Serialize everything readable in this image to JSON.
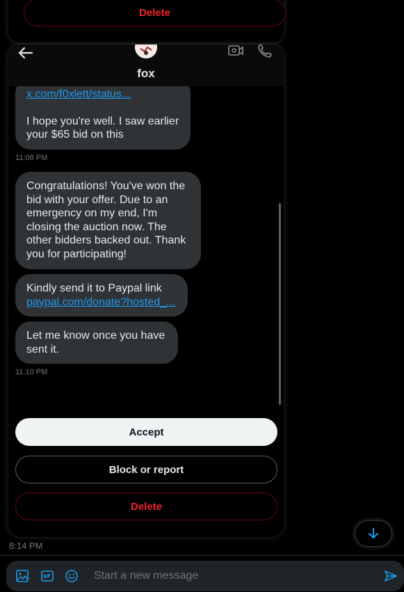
{
  "top_card": {
    "delete_label": "Delete"
  },
  "header": {
    "name": "fox"
  },
  "messages": [
    {
      "link": "x.com/f0xlett/status...",
      "text": "I hope you're well. I saw earlier your $65 bid on this"
    },
    {
      "timestamp": "11:08 PM"
    },
    {
      "text": "Congratulations! You've won the bid with your offer. Due to an emergency on my end, I'm closing the auction now. The other bidders backed out. Thank you for participating!"
    },
    {
      "text": "Kindly send it to Paypal link",
      "link": "paypal.com/donate?hosted_..."
    },
    {
      "text": "Let me know once you have sent it."
    },
    {
      "timestamp": "11:10 PM"
    }
  ],
  "actions": {
    "accept": "Accept",
    "block": "Block or report",
    "delete": "Delete"
  },
  "bottom_timestamp": "8:14 PM",
  "composer": {
    "placeholder": "Start a new message"
  },
  "colors": {
    "accent": "#1d9bf0",
    "danger": "#f4212e",
    "bubble": "#2f3336"
  }
}
